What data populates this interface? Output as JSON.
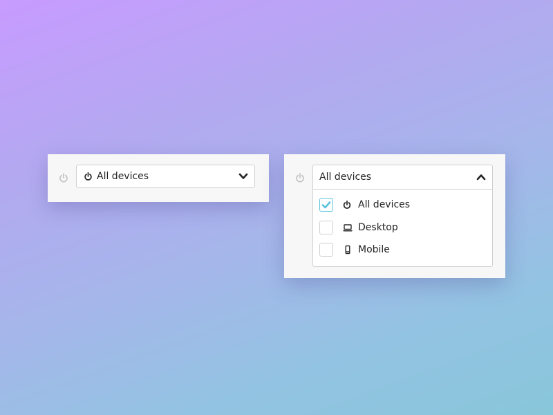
{
  "colors": {
    "accent": "#5bc2dc",
    "border": "#cfcfcf",
    "card": "#f7f7f7",
    "text": "#222222",
    "icon_muted": "#c6c6c6"
  },
  "closed_select": {
    "side_icon": "power-icon",
    "selected_icon": "power-icon",
    "selected_label": "All devices",
    "toggle_icon": "chevron-down-icon"
  },
  "open_select": {
    "side_icon": "power-icon",
    "header_label": "All devices",
    "toggle_icon": "chevron-up-icon",
    "options": [
      {
        "label": "All devices",
        "icon": "power-icon",
        "checked": true
      },
      {
        "label": "Desktop",
        "icon": "laptop-icon",
        "checked": false
      },
      {
        "label": "Mobile",
        "icon": "mobile-phone-icon",
        "checked": false
      }
    ]
  }
}
